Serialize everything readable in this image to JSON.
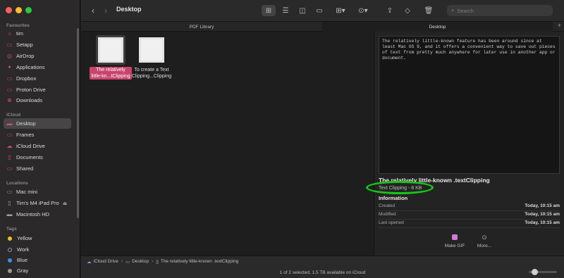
{
  "window": {
    "title": "Desktop"
  },
  "sidebar": {
    "favourites_header": "Favourites",
    "favourites": [
      {
        "label": "tim",
        "icon": "home-icon"
      },
      {
        "label": "Setapp",
        "icon": "folder-icon"
      },
      {
        "label": "AirDrop",
        "icon": "airdrop-icon"
      },
      {
        "label": "Applications",
        "icon": "applications-icon"
      },
      {
        "label": "Dropbox",
        "icon": "folder-icon"
      },
      {
        "label": "Proton Drive",
        "icon": "folder-icon"
      },
      {
        "label": "Downloads",
        "icon": "downloads-icon"
      }
    ],
    "icloud_header": "iCloud",
    "icloud": [
      {
        "label": "Desktop",
        "icon": "desktop-icon",
        "selected": true
      },
      {
        "label": "Frames",
        "icon": "folder-icon"
      },
      {
        "label": "iCloud Drive",
        "icon": "cloud-icon"
      },
      {
        "label": "Documents",
        "icon": "document-icon"
      },
      {
        "label": "Shared",
        "icon": "shared-folder-icon"
      }
    ],
    "locations_header": "Locations",
    "locations": [
      {
        "label": "Mac mini",
        "icon": "computer-icon"
      },
      {
        "label": "Tim's M4 iPad Pro",
        "icon": "ipad-icon"
      },
      {
        "label": "Macintosh HD",
        "icon": "disk-icon"
      }
    ],
    "tags_header": "Tags",
    "tags": [
      {
        "label": "Yellow",
        "color": "#f2c01e"
      },
      {
        "label": "Work",
        "color": "#2b2929"
      },
      {
        "label": "Blue",
        "color": "#3b8ef2"
      },
      {
        "label": "Gray",
        "color": "#9a9a9a"
      }
    ]
  },
  "toolbar": {
    "search_placeholder": "Search"
  },
  "tabs": [
    {
      "label": "PDF Library",
      "active": false
    },
    {
      "label": "Desktop",
      "active": true
    }
  ],
  "files": [
    {
      "name_line1": "The relatively",
      "name_line2": "little-kn...tClipping",
      "selected": true
    },
    {
      "name_line1": "To create a Text",
      "name_line2": "Clipping...Clipping",
      "selected": false
    }
  ],
  "preview": {
    "content": "The relatively little-known feature has been around since at least Mac OS 9, and it offers a convenient way to save out pieces of text from pretty much anywhere for later use in another app or document.",
    "title": "The relatively little-known .textClipping",
    "subtitle": "Text Clipping - 8 KB",
    "info_header": "Information",
    "info": [
      {
        "label": "Created",
        "value": "Today, 10:15 am"
      },
      {
        "label": "Modified",
        "value": "Today, 10:15 am"
      },
      {
        "label": "Last opened",
        "value": "Today, 10:15 am"
      }
    ],
    "actions": [
      {
        "label": "Make GIF"
      },
      {
        "label": "More..."
      }
    ]
  },
  "pathbar": [
    "iCloud Drive",
    "Desktop",
    "The relatively little-known .textClipping"
  ],
  "status": "1 of 2 selected, 1.5 TB available on iCloud",
  "colors": {
    "accent": "#c9446d",
    "highlight_ring": "#14c814"
  }
}
